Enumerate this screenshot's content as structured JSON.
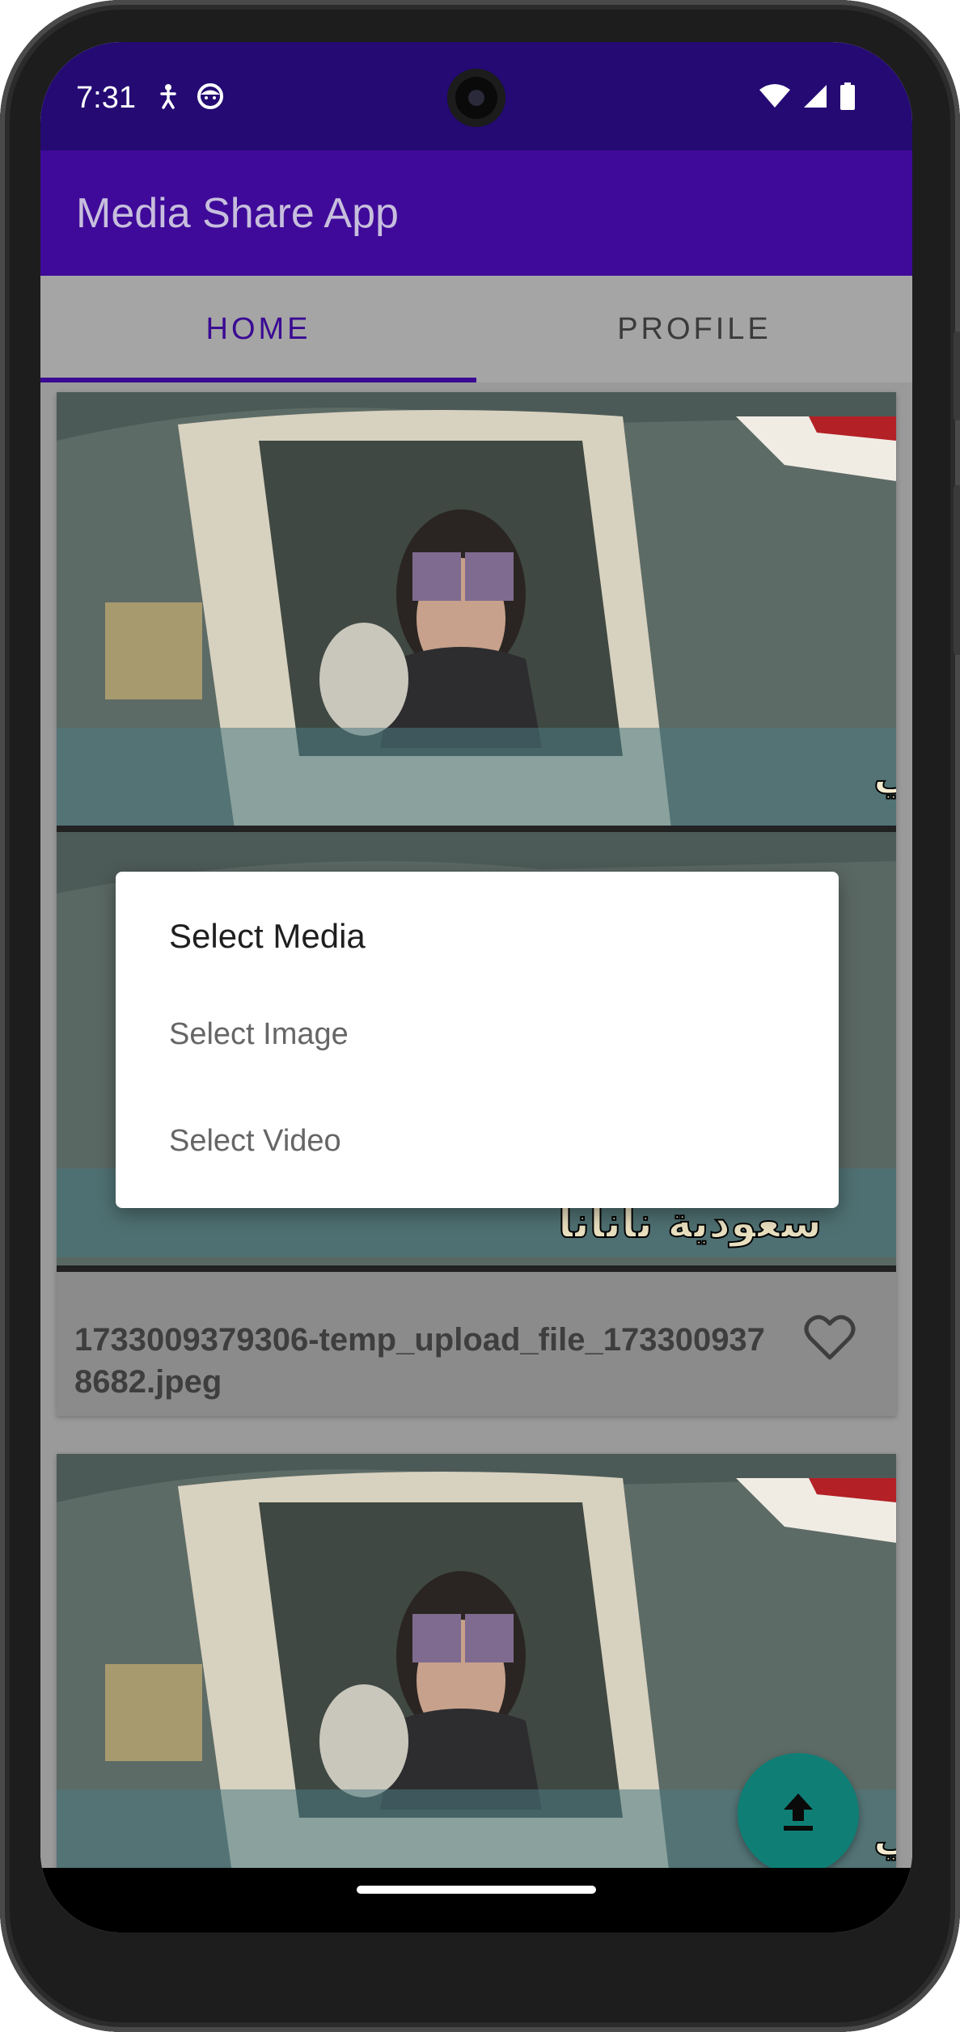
{
  "status_bar": {
    "time": "7:31",
    "left_icons": [
      "accessibility-icon",
      "face-icon"
    ],
    "right_icons": [
      "wifi-icon",
      "signal-icon",
      "battery-icon"
    ]
  },
  "app_bar": {
    "title": "Media Share App",
    "color": "#3f0a99"
  },
  "tabs": [
    {
      "label": "HOME",
      "active": true
    },
    {
      "label": "PROFILE",
      "active": false
    }
  ],
  "feed": {
    "items": [
      {
        "caption_overlay_top": "إحنا محتاجين فتح إسلامي جديد واللهي",
        "caption_overlay_bottom": "سعودية نانانا",
        "file_name": "1733009379306-temp_upload_file_1733009378682.jpeg",
        "like_icon": "heart-outline-icon"
      },
      {
        "caption_overlay_top": "إحنا محتاجين فتح إسلامي جديد واللهي"
      }
    ]
  },
  "fab": {
    "icon": "upload-icon",
    "color": "#0f7f76"
  },
  "dialog": {
    "title": "Select Media",
    "options": [
      "Select Image",
      "Select Video"
    ]
  }
}
